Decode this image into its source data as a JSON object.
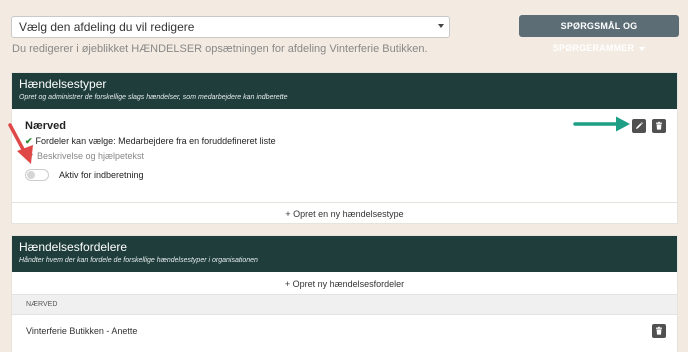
{
  "department_select": {
    "value": "Vælg den afdeling du vil redigere"
  },
  "info_text": "Du redigerer i øjeblikket HÆNDELSER opsætningen for afdeling Vinterferie Butikken.",
  "top_button": {
    "label": "SPØRGSMÅL OG SPØRGERAMMER"
  },
  "event_types_card": {
    "title": "Hændelsestyper",
    "subtitle": "Opret og administrer de forskellige slags hændelser, som medarbejdere kan indberette",
    "item": {
      "name": "Nærved",
      "assignment": "Fordeler kan vælge: Medarbejdere fra en foruddefineret liste",
      "description_toggle": "Beskrivelse og hjælpetekst",
      "active_label": "Aktiv for indberetning",
      "active": false
    },
    "create_label": "+ Opret en ny hændelsestype"
  },
  "distributors_card": {
    "title": "Hændelsesfordelere",
    "subtitle": "Håndter hvem der kan fordele de forskellige hændelsestyper i organisationen",
    "create_label": "+ Opret ny hændelsesfordeler",
    "group_header": "NÆRVED",
    "rows": [
      {
        "label": "Vinterferie Butikken - Anette"
      }
    ]
  },
  "colors": {
    "page_bg": "#f3ebe1",
    "card_header_bg": "#1e3d3b",
    "top_button_bg": "#5c6d76",
    "icon_button_bg": "#505050",
    "annotation_green": "#1f9e86",
    "annotation_red": "#e04848",
    "check_green": "#2e8b3a"
  },
  "icons": [
    "chevron-down-icon",
    "pencil-icon",
    "trash-icon",
    "check-icon",
    "chevron-icon",
    "arrow-annotation-icon"
  ]
}
